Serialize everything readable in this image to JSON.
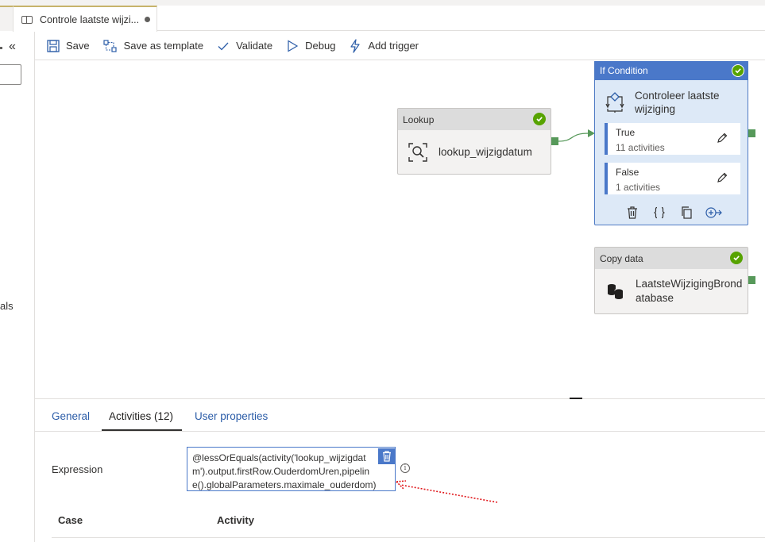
{
  "tab": {
    "title": "Controle laatste wijzi...",
    "icon": "pipeline-icon"
  },
  "left_panel": {
    "collapse_glyph": "«",
    "partial_text": "als"
  },
  "toolbar": {
    "save": "Save",
    "save_template": "Save as template",
    "validate": "Validate",
    "debug": "Debug",
    "add_trigger": "Add trigger"
  },
  "activities": {
    "lookup": {
      "type": "Lookup",
      "name": "lookup_wijzigdatum",
      "status": "succeeded"
    },
    "if_condition": {
      "type": "If Condition",
      "name_line1": "Controleer laatste",
      "name_line2": "wijziging",
      "status": "succeeded",
      "cases": [
        {
          "name": "True",
          "count": "11 activities"
        },
        {
          "name": "False",
          "count": "1 activities"
        }
      ]
    },
    "copy": {
      "type": "Copy data",
      "name_line1": "LaatsteWijzigingBrond",
      "name_line2": "atabase",
      "status": "succeeded"
    }
  },
  "panel": {
    "tabs": [
      {
        "label": "General",
        "active": false
      },
      {
        "label": "Activities (12)",
        "active": true
      },
      {
        "label": "User properties",
        "active": false
      }
    ],
    "expression_label": "Expression",
    "expression_lines": [
      "@lessOrEquals(activity('lookup_wijzigdat",
      "m').output.firstRow.OuderdomUren,pipelin",
      "e().globalParameters.maximale_ouderdom)"
    ],
    "table_headers": {
      "case": "Case",
      "activity": "Activity"
    }
  },
  "colors": {
    "accent": "#4a78c9",
    "success": "#57a300",
    "link": "#2c5da8"
  }
}
